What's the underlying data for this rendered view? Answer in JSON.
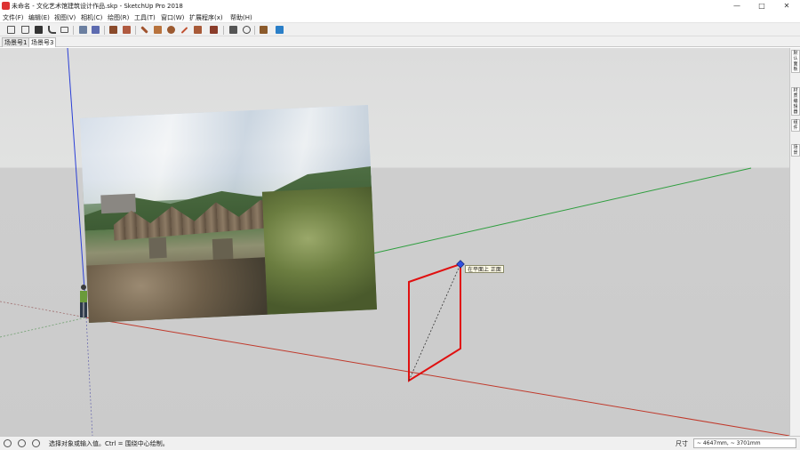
{
  "window": {
    "title": "未命名 - 文化艺术馆建筑设计作品.skp - SketchUp Pro 2018",
    "minimize_glyph": "—",
    "maximize_glyph": "□",
    "close_glyph": "✕"
  },
  "menu": {
    "items": [
      "文件(F)",
      "编辑(E)",
      "视图(V)",
      "相机(C)",
      "绘图(R)",
      "工具(T)",
      "窗口(W)",
      "扩展程序(x)",
      "帮助(H)"
    ]
  },
  "toolbar": {
    "icons": [
      "new-file-icon",
      "open-file-icon",
      "save-icon",
      "undo-icon",
      "print-icon",
      "model-info-icon",
      "component-icon",
      "paint-bucket-icon",
      "eraser-icon",
      "pencil-icon",
      "rectangle-icon",
      "circle-icon",
      "line-icon",
      "push-pull-icon",
      "move-icon",
      "tape-measure-icon",
      "orbit-icon",
      "pan-icon",
      "warehouse-icon",
      "extension-icon"
    ]
  },
  "scenes": {
    "tabs": [
      "场景号1",
      "场景号3"
    ],
    "active_index": 1
  },
  "viewport": {
    "tooltip": "在平面上 正面",
    "axis_colors": {
      "red": "#c0392b",
      "green": "#2e9e3e",
      "blue": "#2b3fd6"
    },
    "rectangle_color": "#e01010",
    "inference_point_color": "#3050e0"
  },
  "tray": {
    "tabs": [
      "默认面板",
      "材质编辑器",
      "组件",
      "场景"
    ]
  },
  "status": {
    "message": "选择对象或输入值。Ctrl = 围绕中心绘制。",
    "measurement_label": "尺寸",
    "measurement_value": "~ 4647mm, ~ 3701mm",
    "icons": [
      "geolocation-icon",
      "credits-icon",
      "user-icon"
    ]
  }
}
